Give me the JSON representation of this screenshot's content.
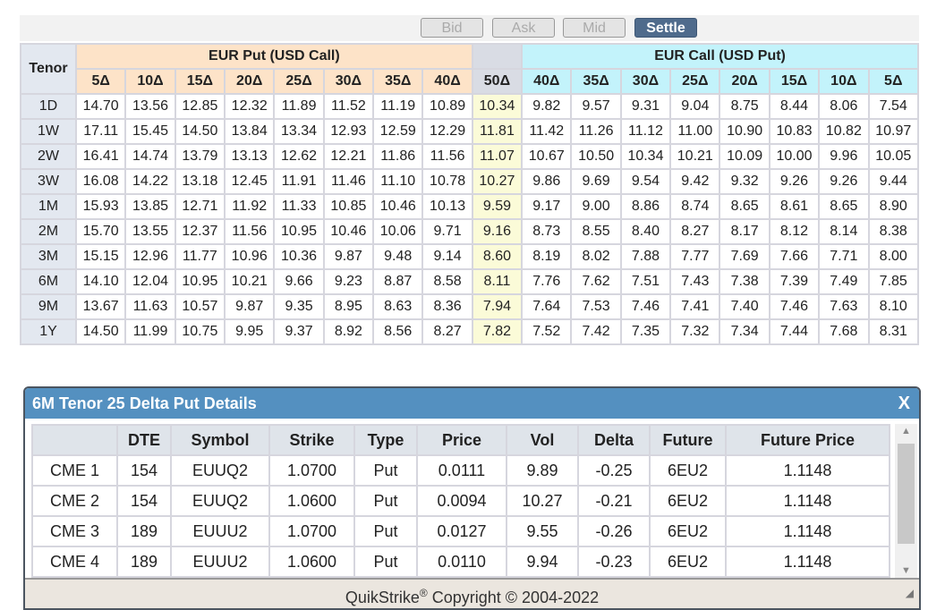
{
  "toolbar": {
    "buttons": [
      "Bid",
      "Ask",
      "Mid",
      "Settle"
    ],
    "active": "Settle"
  },
  "grid": {
    "tenor_label": "Tenor",
    "put_group": "EUR Put (USD Call)",
    "call_group": "EUR Call (USD Put)",
    "put_cols": [
      "5Δ",
      "10Δ",
      "15Δ",
      "20Δ",
      "25Δ",
      "30Δ",
      "35Δ",
      "40Δ"
    ],
    "atm_col": "50Δ",
    "call_cols": [
      "40Δ",
      "35Δ",
      "30Δ",
      "25Δ",
      "20Δ",
      "15Δ",
      "10Δ",
      "5Δ"
    ],
    "rows": [
      {
        "tenor": "1D",
        "values": [
          "14.70",
          "13.56",
          "12.85",
          "12.32",
          "11.89",
          "11.52",
          "11.19",
          "10.89",
          "10.34",
          "9.82",
          "9.57",
          "9.31",
          "9.04",
          "8.75",
          "8.44",
          "8.06",
          "7.54"
        ]
      },
      {
        "tenor": "1W",
        "values": [
          "17.11",
          "15.45",
          "14.50",
          "13.84",
          "13.34",
          "12.93",
          "12.59",
          "12.29",
          "11.81",
          "11.42",
          "11.26",
          "11.12",
          "11.00",
          "10.90",
          "10.83",
          "10.82",
          "10.97"
        ]
      },
      {
        "tenor": "2W",
        "values": [
          "16.41",
          "14.74",
          "13.79",
          "13.13",
          "12.62",
          "12.21",
          "11.86",
          "11.56",
          "11.07",
          "10.67",
          "10.50",
          "10.34",
          "10.21",
          "10.09",
          "10.00",
          "9.96",
          "10.05"
        ]
      },
      {
        "tenor": "3W",
        "values": [
          "16.08",
          "14.22",
          "13.18",
          "12.45",
          "11.91",
          "11.46",
          "11.10",
          "10.78",
          "10.27",
          "9.86",
          "9.69",
          "9.54",
          "9.42",
          "9.32",
          "9.26",
          "9.26",
          "9.44"
        ]
      },
      {
        "tenor": "1M",
        "values": [
          "15.93",
          "13.85",
          "12.71",
          "11.92",
          "11.33",
          "10.85",
          "10.46",
          "10.13",
          "9.59",
          "9.17",
          "9.00",
          "8.86",
          "8.74",
          "8.65",
          "8.61",
          "8.65",
          "8.90"
        ]
      },
      {
        "tenor": "2M",
        "values": [
          "15.70",
          "13.55",
          "12.37",
          "11.56",
          "10.95",
          "10.46",
          "10.06",
          "9.71",
          "9.16",
          "8.73",
          "8.55",
          "8.40",
          "8.27",
          "8.17",
          "8.12",
          "8.14",
          "8.38"
        ]
      },
      {
        "tenor": "3M",
        "values": [
          "15.15",
          "12.96",
          "11.77",
          "10.96",
          "10.36",
          "9.87",
          "9.48",
          "9.14",
          "8.60",
          "8.19",
          "8.02",
          "7.88",
          "7.77",
          "7.69",
          "7.66",
          "7.71",
          "8.00"
        ]
      },
      {
        "tenor": "6M",
        "values": [
          "14.10",
          "12.04",
          "10.95",
          "10.21",
          "9.66",
          "9.23",
          "8.87",
          "8.58",
          "8.11",
          "7.76",
          "7.62",
          "7.51",
          "7.43",
          "7.38",
          "7.39",
          "7.49",
          "7.85"
        ]
      },
      {
        "tenor": "9M",
        "values": [
          "13.67",
          "11.63",
          "10.57",
          "9.87",
          "9.35",
          "8.95",
          "8.63",
          "8.36",
          "7.94",
          "7.64",
          "7.53",
          "7.46",
          "7.41",
          "7.40",
          "7.46",
          "7.63",
          "8.10"
        ]
      },
      {
        "tenor": "1Y",
        "values": [
          "14.50",
          "11.99",
          "10.75",
          "9.95",
          "9.37",
          "8.92",
          "8.56",
          "8.27",
          "7.82",
          "7.52",
          "7.42",
          "7.35",
          "7.32",
          "7.34",
          "7.44",
          "7.68",
          "8.31"
        ]
      }
    ]
  },
  "details": {
    "title": "6M Tenor 25 Delta Put Details",
    "close": "X",
    "headers": [
      "",
      "DTE",
      "Symbol",
      "Strike",
      "Type",
      "Price",
      "Vol",
      "Delta",
      "Future",
      "Future Price"
    ],
    "rows": [
      [
        "CME 1",
        "154",
        "EUUQ2",
        "1.0700",
        "Put",
        "0.0111",
        "9.89",
        "-0.25",
        "6EU2",
        "1.1148"
      ],
      [
        "CME 2",
        "154",
        "EUUQ2",
        "1.0600",
        "Put",
        "0.0094",
        "10.27",
        "-0.21",
        "6EU2",
        "1.1148"
      ],
      [
        "CME 3",
        "189",
        "EUUU2",
        "1.0700",
        "Put",
        "0.0127",
        "9.55",
        "-0.26",
        "6EU2",
        "1.1148"
      ],
      [
        "CME 4",
        "189",
        "EUUU2",
        "1.0600",
        "Put",
        "0.0110",
        "9.94",
        "-0.23",
        "6EU2",
        "1.1148"
      ]
    ],
    "footer_brand": "QuikStrike",
    "footer_reg": "®",
    "footer_copy": "Copyright © 2004-2022"
  }
}
